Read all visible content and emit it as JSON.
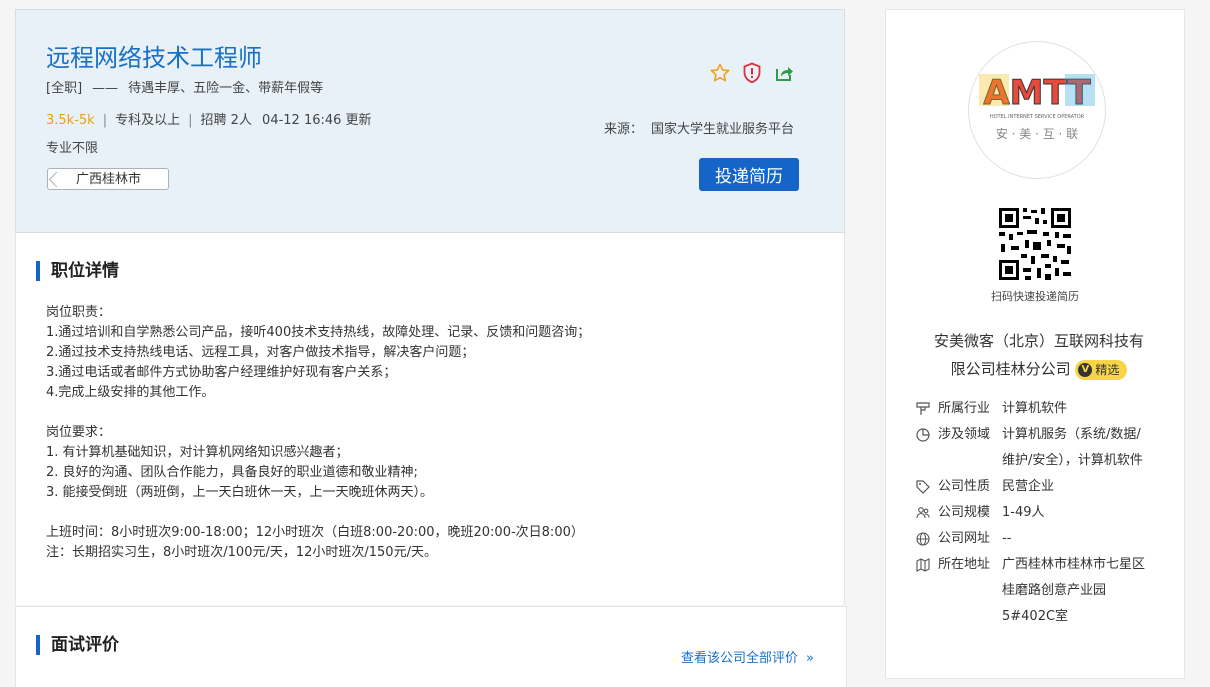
{
  "job": {
    "title": "远程网络技术工程师",
    "type": "[全职]",
    "dash": "——",
    "benefits": "待遇丰厚、五险一金、带薪年假等",
    "salary": "3.5k-5k",
    "education": "专科及以上",
    "recruit": "招聘 2人",
    "updated": "04-12 16:46 更新",
    "major": "专业不限",
    "location": "广西桂林市",
    "source_label": "来源：",
    "source": "国家大学生就业服务平台",
    "apply_label": "投递简历",
    "icons": [
      "star-icon",
      "shield-report-icon",
      "share-icon"
    ]
  },
  "detail": {
    "title": "职位详情",
    "lines": [
      "岗位职责：",
      "1.通过培训和自学熟悉公司产品，接听400技术支持热线，故障处理、记录、反馈和问题咨询；",
      "2.通过技术支持热线电话、远程工具，对客户做技术指导，解决客户问题；",
      "3.通过电话或者邮件方式协助客户经理维护好现有客户关系；",
      "4.完成上级安排的其他工作。",
      "",
      "岗位要求：",
      "1. 有计算机基础知识，对计算机网络知识感兴趣者；",
      "2. 良好的沟通、团队合作能力，具备良好的职业道德和敬业精神;",
      "3. 能接受倒班（两班倒，上一天白班休一天，上一天晚班休两天）。",
      "",
      "上班时间：8小时班次9:00-18:00；12小时班次（白班8:00-20:00，晚班20:00-次日8:00）",
      "注：长期招实习生，8小时班次/100元/天，12小时班次/150元/天。"
    ]
  },
  "review": {
    "title": "面试评价",
    "link": "查看该公司全部评价",
    "chevron": "»"
  },
  "company": {
    "logo_text": "AMTT",
    "logo_subtext": "HOTEL INTERNET SERVICE OPERATOR",
    "logo_cn": "安 · 美 · 互 · 联",
    "qr_label": "扫码快速投递简历",
    "name_line1": "安美微客（北京）互联网科技有",
    "name_line2": "限公司桂林分公司",
    "badge_v": "V",
    "badge": "精选",
    "colors": {
      "brand_blue": "#1565c8",
      "salary_orange": "#f39c12",
      "badge_yellow": "#f8d546"
    },
    "info": [
      {
        "icon": "industry-icon",
        "label": "所属行业",
        "value": "计算机软件"
      },
      {
        "icon": "domain-pie-icon",
        "label": "涉及领域",
        "value": "计算机服务（系统/数据/维护/安全），计算机软件"
      },
      {
        "icon": "tag-icon",
        "label": "公司性质",
        "value": "民营企业"
      },
      {
        "icon": "people-icon",
        "label": "公司规模",
        "value": "1-49人"
      },
      {
        "icon": "globe-icon",
        "label": "公司网址",
        "value": "--"
      },
      {
        "icon": "map-icon",
        "label": "所在地址",
        "value": "广西桂林市桂林市七星区桂磨路创意产业园5#402C室"
      }
    ]
  }
}
